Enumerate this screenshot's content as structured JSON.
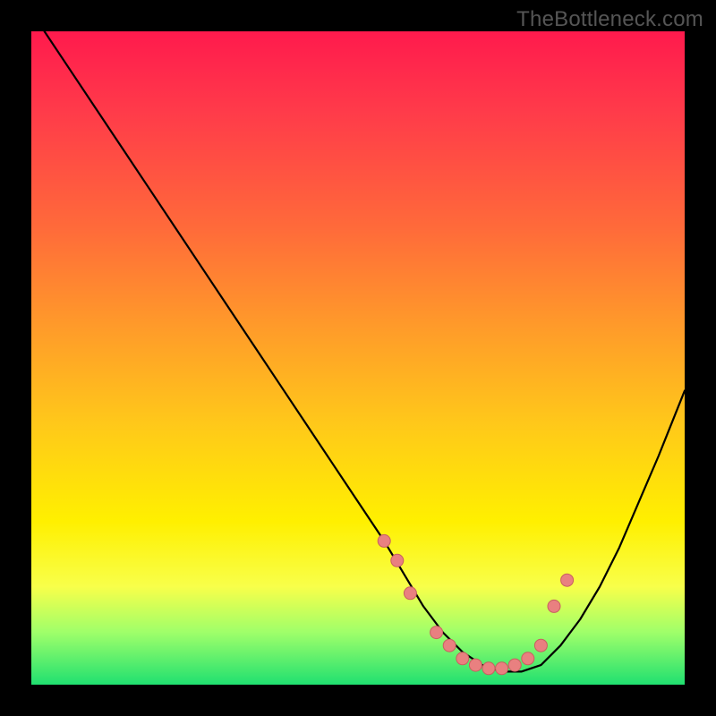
{
  "watermark": "TheBottleneck.com",
  "colors": {
    "background": "#000000",
    "curve": "#000000",
    "dot_fill": "#e98080",
    "dot_stroke": "#c86060"
  },
  "chart_data": {
    "type": "line",
    "title": "",
    "xlabel": "",
    "ylabel": "",
    "xlim": [
      0,
      100
    ],
    "ylim": [
      0,
      100
    ],
    "grid": false,
    "legend": false,
    "series": [
      {
        "name": "bottleneck-curve",
        "x": [
          2,
          6,
          10,
          14,
          18,
          22,
          26,
          30,
          34,
          38,
          42,
          46,
          50,
          54,
          57,
          60,
          63,
          66,
          69,
          72,
          75,
          78,
          81,
          84,
          87,
          90,
          93,
          96,
          100
        ],
        "y": [
          100,
          94,
          88,
          82,
          76,
          70,
          64,
          58,
          52,
          46,
          40,
          34,
          28,
          22,
          17,
          12,
          8,
          5,
          3,
          2,
          2,
          3,
          6,
          10,
          15,
          21,
          28,
          35,
          45
        ]
      }
    ],
    "highlight_points": {
      "name": "marker-dots",
      "x": [
        54,
        56,
        58,
        62,
        64,
        66,
        68,
        70,
        72,
        74,
        76,
        78,
        80,
        82
      ],
      "y": [
        22,
        19,
        14,
        8,
        6,
        4,
        3,
        2.5,
        2.5,
        3,
        4,
        6,
        12,
        16
      ]
    }
  }
}
